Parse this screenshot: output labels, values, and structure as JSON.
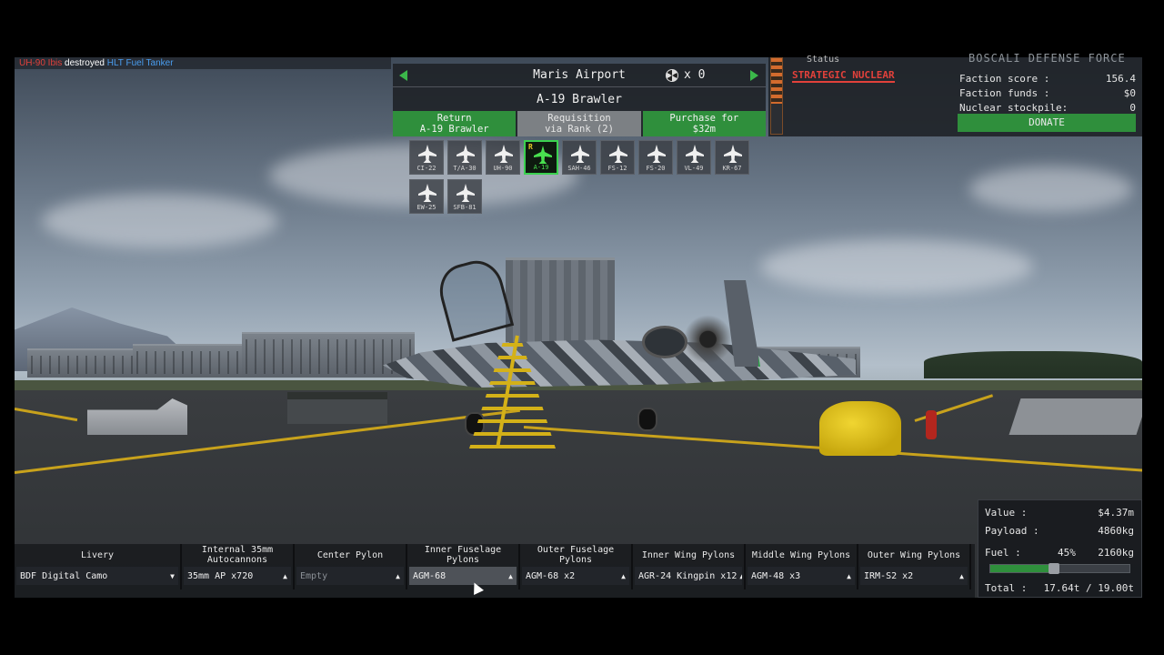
{
  "killfeed": {
    "killer": "UH-90 Ibis",
    "verb": "destroyed",
    "victim": "HLT Fuel Tanker"
  },
  "airport": {
    "name": "Maris Airport",
    "nuke_count": "x 0",
    "aircraft_name": "A-19 Brawler"
  },
  "actions": {
    "return": "Return\nA-19 Brawler",
    "requisition": "Requisition\nvia Rank (2)",
    "purchase": "Purchase for\n$32m"
  },
  "status": {
    "label": "Status",
    "value": "STRATEGIC NUCLEAR"
  },
  "faction": {
    "name": "BOSCALI DEFENSE FORCE",
    "score_label": "Faction score :",
    "score_value": "156.4",
    "funds_label": "Faction funds :",
    "funds_value": "$0",
    "stockpile_label": "Nuclear stockpile:",
    "stockpile_value": "0",
    "donate_label": "DONATE"
  },
  "aircraft_tiles": [
    {
      "label": "CI-22"
    },
    {
      "label": "T/A-30"
    },
    {
      "label": "UH-90"
    },
    {
      "label": "A-19",
      "rank": "R",
      "selected": true
    },
    {
      "label": "SAH-46"
    },
    {
      "label": "FS-12"
    },
    {
      "label": "FS-20"
    },
    {
      "label": "VL-49"
    },
    {
      "label": "KR-67"
    },
    {
      "label": "EW-25"
    },
    {
      "label": "SFB-81"
    }
  ],
  "loadout": [
    {
      "title": "Livery",
      "value": "BDF Digital Camo",
      "caret": "▼"
    },
    {
      "title": "Internal 35mm Autocannons",
      "value": "35mm AP x720",
      "caret": "▲"
    },
    {
      "title": "Center Pylon",
      "value": "Empty",
      "caret": "▲"
    },
    {
      "title": "Inner Fuselage Pylons",
      "value": "AGM-68",
      "caret": "▲"
    },
    {
      "title": "Outer Fuselage Pylons",
      "value": "AGM-68 x2",
      "caret": "▲"
    },
    {
      "title": "Inner Wing Pylons",
      "value": "AGR-24 Kingpin x12",
      "caret": "▲"
    },
    {
      "title": "Middle Wing Pylons",
      "value": "AGM-48 x3",
      "caret": "▲"
    },
    {
      "title": "Outer Wing Pylons",
      "value": "IRM-S2 x2",
      "caret": "▲"
    }
  ],
  "stats": {
    "value_label": "Value :",
    "value": "$4.37m",
    "payload_label": "Payload :",
    "payload": "4860kg",
    "fuel_label": "Fuel :",
    "fuel_pct": "45%",
    "fuel_kg": "2160kg",
    "fuel_fraction": 0.45,
    "total_label": "Total :",
    "total": "17.64t / 19.00t"
  },
  "colors": {
    "accent_green": "#2f8f3c",
    "selected_green": "#3bd150",
    "alert_red": "#e2413b",
    "info_blue": "#4a9ef0"
  }
}
